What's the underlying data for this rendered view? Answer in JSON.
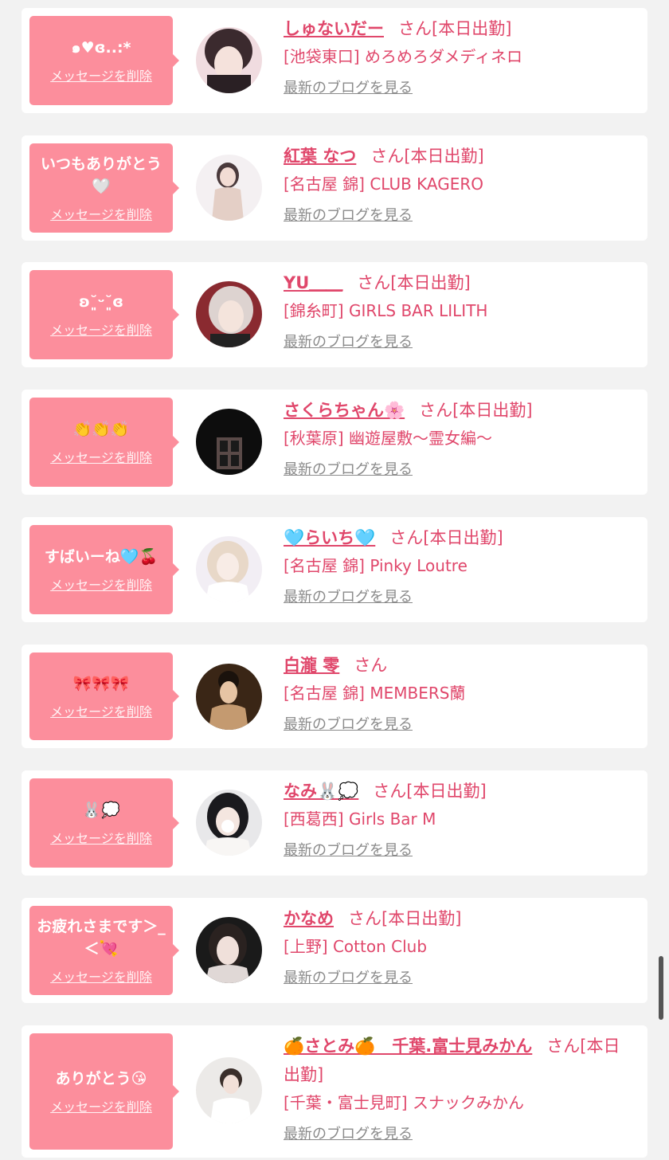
{
  "colors": {
    "accent": "#e0476b",
    "bubble": "#fc8e9c",
    "link_gray": "#8a8a8a",
    "background": "#f2f2f2"
  },
  "delete_label": "メッセージを削除",
  "blog_label": "最新のブログを見る",
  "san_label": "さん",
  "today_badge": "[本日出勤]",
  "items": [
    {
      "message": "๑♥ɞ..:*",
      "name": "しゅないだー",
      "area": "[池袋東口]",
      "shop": "めろめろダメディネロ",
      "today": "[本日出勤]",
      "avatar_colors": [
        "#f0dce0",
        "#3b2a2e"
      ]
    },
    {
      "message": "いつもありがとう🤍",
      "name": "紅葉 なつ",
      "area": "[名古屋 錦]",
      "shop": "CLUB KAGERO",
      "today": "[本日出勤]",
      "avatar_colors": [
        "#f4f0f2",
        "#4a3a3c"
      ]
    },
    {
      "message": "ʚ˘͈ᵕ˘͈ɞ",
      "name": "YU＿＿",
      "area": "[錦糸町]",
      "shop": "GIRLS BAR LILITH",
      "today": "[本日出勤]",
      "avatar_colors": [
        "#8a2a30",
        "#ddd3d0"
      ]
    },
    {
      "message": "👏👏👏",
      "name": "さくらちゃん🌸",
      "area": "[秋葉原]",
      "shop": "幽遊屋敷〜霊女編〜",
      "today": "[本日出勤]",
      "avatar_colors": [
        "#0d0d0d",
        "#5a4a48"
      ]
    },
    {
      "message": "すばいーね🩵🍒",
      "name": "🩵らいち🩵",
      "area": "[名古屋 錦]",
      "shop": "Pinky Loutre",
      "today": "[本日出勤]",
      "avatar_colors": [
        "#f2eef4",
        "#e8d8c8"
      ]
    },
    {
      "message": "🎀🎀🎀",
      "name": "白瀧 零",
      "area": "[名古屋 錦]",
      "shop": "MEMBERS蘭",
      "today": "",
      "avatar_colors": [
        "#3a2616",
        "#c49a70"
      ]
    },
    {
      "message": "🐰💭",
      "name": "なみ🐰💭",
      "area": "[西葛西]",
      "shop": "Girls Bar M",
      "today": "[本日出勤]",
      "avatar_colors": [
        "#e8e8ea",
        "#1a1a1e"
      ]
    },
    {
      "message": "お疲れさまです＞_＜💘",
      "name": "かなめ",
      "area": "[上野]",
      "shop": "Cotton Club",
      "today": "[本日出勤]",
      "avatar_colors": [
        "#1a1a1a",
        "#e0d8d6"
      ]
    },
    {
      "message": "ありがとう😘",
      "name": "🍊さとみ🍊　千葉.富士見みかん",
      "area": "[千葉・富士見町]",
      "shop": "スナックみかん",
      "today": "[本日出勤]",
      "avatar_colors": [
        "#eceae8",
        "#3a2e2a"
      ]
    }
  ]
}
